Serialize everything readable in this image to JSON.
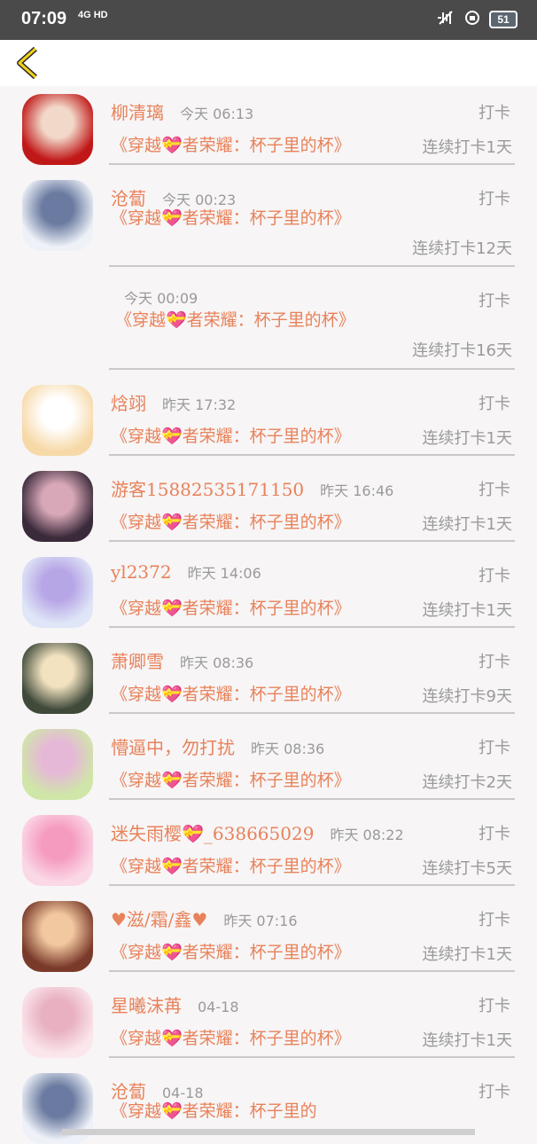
{
  "status_bar": {
    "time": "07:09",
    "network": "4G HD",
    "battery": "51"
  },
  "items": [
    {
      "name": "柳清璃",
      "time": "今天 06:13",
      "action": "打卡",
      "book": "《穿越💝者荣耀：杯子里的杯》",
      "streak": "连续打卡1天",
      "avatar_colors": [
        "#c01818",
        "#f2d8c9"
      ]
    },
    {
      "name": "沧蔔",
      "time": "今天 00:23",
      "action": "打卡",
      "book": "《穿越💝者荣耀：杯子里的杯》",
      "streak": "连续打卡12天",
      "avatar_colors": [
        "#eef2f8",
        "#6a7aa0"
      ]
    },
    {
      "name": "",
      "time": "今天 00:09",
      "action": "打卡",
      "book": "《穿越💝者荣耀：杯子里的杯》",
      "streak": "连续打卡16天",
      "avatar_colors": []
    },
    {
      "name": "焓翊",
      "time": "昨天 17:32",
      "action": "打卡",
      "book": "《穿越💝者荣耀：杯子里的杯》",
      "streak": "连续打卡1天",
      "avatar_colors": [
        "#f7d9a8",
        "#ffffff"
      ]
    },
    {
      "name": "游客15882535171150",
      "time": "昨天 16:46",
      "action": "打卡",
      "book": "《穿越💝者荣耀：杯子里的杯》",
      "streak": "连续打卡1天",
      "avatar_colors": [
        "#3a2a3a",
        "#d9a8b8"
      ]
    },
    {
      "name": "yl2372",
      "time": "昨天 14:06",
      "action": "打卡",
      "book": "《穿越💝者荣耀：杯子里的杯》",
      "streak": "连续打卡1天",
      "avatar_colors": [
        "#dfe6f7",
        "#b7a6e6"
      ]
    },
    {
      "name": "萧卿雪",
      "time": "昨天 08:36",
      "action": "打卡",
      "book": "《穿越💝者荣耀：杯子里的杯》",
      "streak": "连续打卡9天",
      "avatar_colors": [
        "#3f4a3a",
        "#f2e2c0"
      ]
    },
    {
      "name": "懵逼中，勿打扰",
      "time": "昨天 08:36",
      "action": "打卡",
      "book": "《穿越💝者荣耀：杯子里的杯》",
      "streak": "连续打卡2天",
      "avatar_colors": [
        "#cfe6a8",
        "#e6b8d8"
      ]
    },
    {
      "name": "迷失雨樱💝_638665029",
      "time": "昨天 08:22",
      "action": "打卡",
      "book": "《穿越💝者荣耀：杯子里的杯》",
      "streak": "连续打卡5天",
      "avatar_colors": [
        "#fbd8e6",
        "#f59bc0"
      ]
    },
    {
      "name": "♥滋/霜/鑫♥",
      "time": "昨天 07:16",
      "action": "打卡",
      "book": "《穿越💝者荣耀：杯子里的杯》",
      "streak": "连续打卡1天",
      "avatar_colors": [
        "#7a3a2a",
        "#f2c8a0"
      ]
    },
    {
      "name": "星曦沫苒",
      "time": "04-18",
      "action": "打卡",
      "book": "《穿越💝者荣耀：杯子里的杯》",
      "streak": "连续打卡1天",
      "avatar_colors": [
        "#fbe6ec",
        "#e8b0c0"
      ]
    },
    {
      "name": "沧蔔",
      "time": "04-18",
      "action": "打卡",
      "book": "《穿越💝者荣耀：杯子里的",
      "streak": "",
      "avatar_colors": [
        "#eef2f8",
        "#6a7aa0"
      ]
    }
  ]
}
